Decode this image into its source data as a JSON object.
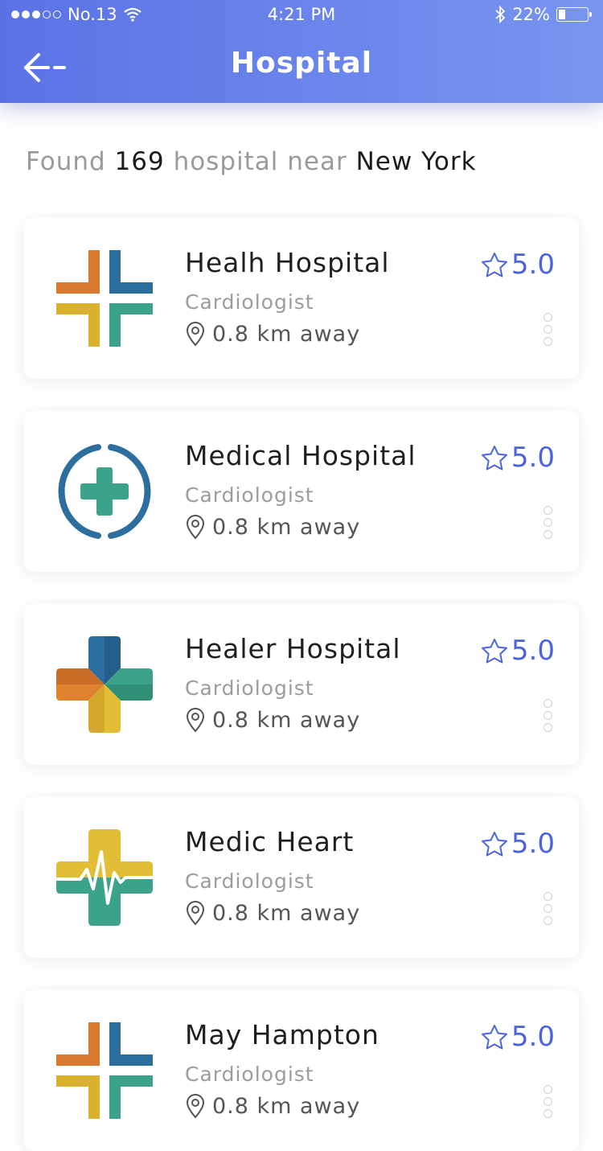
{
  "status_bar": {
    "carrier": "No.13",
    "time": "4:21 PM",
    "battery": "22%"
  },
  "header": {
    "title": "Hospital",
    "back_icon": "back-arrow-icon"
  },
  "summary": {
    "prefix": "Found",
    "count": "169",
    "middle": "hospital near",
    "location": "New York"
  },
  "hospitals": [
    {
      "name": "Healh Hospital",
      "specialty": "Cardiologist",
      "distance": "0.8 km away",
      "rating": "5.0",
      "logo": "split-cross-logo"
    },
    {
      "name": "Medical Hospital",
      "specialty": "Cardiologist",
      "distance": "0.8 km away",
      "rating": "5.0",
      "logo": "ring-cross-logo"
    },
    {
      "name": "Healer Hospital",
      "specialty": "Cardiologist",
      "distance": "0.8 km away",
      "rating": "5.0",
      "logo": "quad-cross-logo"
    },
    {
      "name": "Medic Heart",
      "specialty": "Cardiologist",
      "distance": "0.8 km away",
      "rating": "5.0",
      "logo": "heartbeat-cross-logo"
    },
    {
      "name": "May Hampton",
      "specialty": "Cardiologist",
      "distance": "0.8 km away",
      "rating": "5.0",
      "logo": "split-cross-logo"
    }
  ],
  "colors": {
    "accent": "#4a64e0",
    "header_start": "#5a72e6",
    "header_end": "#7895ef"
  }
}
